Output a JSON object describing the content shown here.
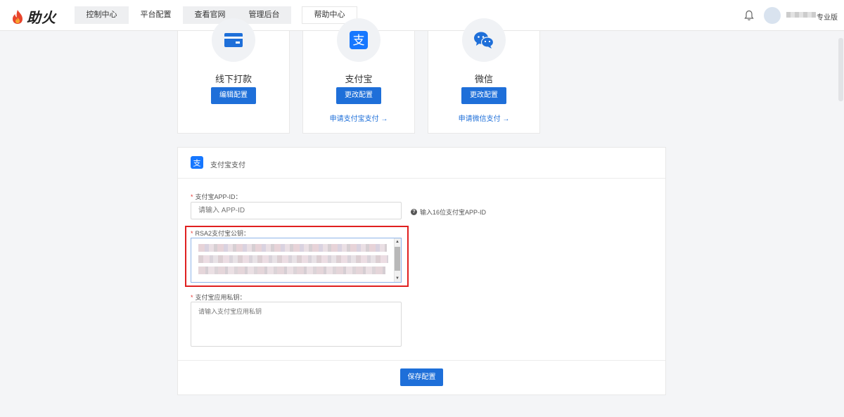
{
  "app": {
    "logo_text": "助火"
  },
  "nav": {
    "items": [
      {
        "label": "控制中心"
      },
      {
        "label": "平台配置",
        "active": true
      },
      {
        "label": "查看官网"
      },
      {
        "label": "管理后台"
      }
    ],
    "help": "帮助中心"
  },
  "user": {
    "plan": "专业版"
  },
  "methods": [
    {
      "name": "线下打款",
      "button": "编辑配置",
      "link": ""
    },
    {
      "name": "支付宝",
      "button": "更改配置",
      "link": "申请支付宝支付 →"
    },
    {
      "name": "微信",
      "button": "更改配置",
      "link": "申请微信支付 →"
    }
  ],
  "panel": {
    "title": "支付宝支付",
    "appid": {
      "label": "支付宝APP-ID：",
      "placeholder": "请输入 APP-ID",
      "hint": "输入16位支付宝APP-ID"
    },
    "rsa": {
      "label": "RSA2支付宝公钥："
    },
    "private_key": {
      "label": "支付宝应用私钥：",
      "placeholder": "请输入支付宝应用私钥"
    },
    "save": "保存配置"
  },
  "colors": {
    "primary": "#1e6fd9",
    "highlight": "#e02020",
    "alipay": "#1677ff",
    "wechat": "#1e6fd9"
  }
}
